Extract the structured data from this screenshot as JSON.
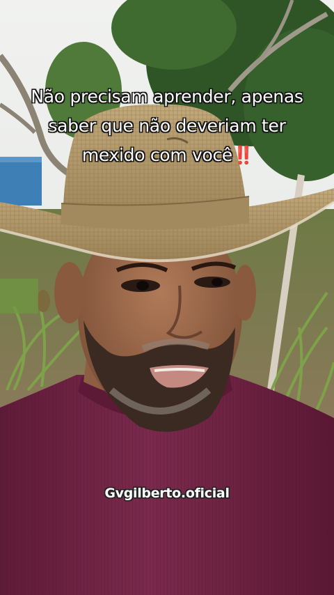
{
  "video": {
    "caption_lines": [
      "Não precisam aprender, apenas",
      "saber que não deveriam ter",
      "mexido com você"
    ],
    "caption_emoji": "‼️",
    "caption_emoji_name": "double-exclamation-icon",
    "watermark": "Gvgilberto.oficial"
  },
  "colors": {
    "sky": "#e9ebe9",
    "foliage": "#3f6a30",
    "hat": "#b39a6c",
    "shirt": "#6f2343",
    "skin": "#9a6a4c"
  }
}
